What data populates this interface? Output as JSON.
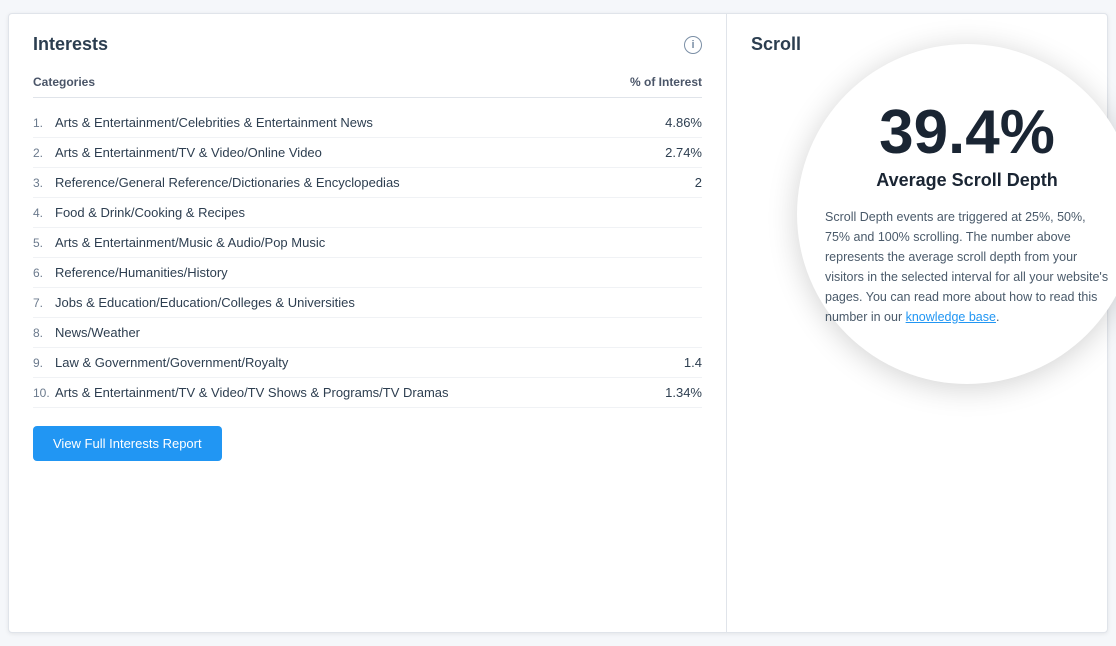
{
  "interests_panel": {
    "title": "Interests",
    "info_icon_label": "i",
    "table": {
      "col_category": "Categories",
      "col_percent": "% of Interest",
      "rows": [
        {
          "num": "1.",
          "name": "Arts & Entertainment/Celebrities & Entertainment News",
          "pct": "4.86%"
        },
        {
          "num": "2.",
          "name": "Arts & Entertainment/TV & Video/Online Video",
          "pct": "2.74%"
        },
        {
          "num": "3.",
          "name": "Reference/General Reference/Dictionaries & Encyclopedias",
          "pct": "2"
        },
        {
          "num": "4.",
          "name": "Food & Drink/Cooking & Recipes",
          "pct": ""
        },
        {
          "num": "5.",
          "name": "Arts & Entertainment/Music & Audio/Pop Music",
          "pct": ""
        },
        {
          "num": "6.",
          "name": "Reference/Humanities/History",
          "pct": ""
        },
        {
          "num": "7.",
          "name": "Jobs & Education/Education/Colleges & Universities",
          "pct": ""
        },
        {
          "num": "8.",
          "name": "News/Weather",
          "pct": ""
        },
        {
          "num": "9.",
          "name": "Law & Government/Government/Royalty",
          "pct": "1.4"
        },
        {
          "num": "10.",
          "name": "Arts & Entertainment/TV & Video/TV Shows & Programs/TV Dramas",
          "pct": "1.34%"
        }
      ]
    },
    "button_label": "View Full Interests Report"
  },
  "scroll_panel": {
    "title": "Scroll",
    "circle": {
      "big_percent": "39.4%",
      "label": "Average Scroll Depth",
      "description_1": "Scroll Depth events are triggered at 25%, 50%, 75% and 100% scrolling. The number above represents the average scroll depth from your visitors in the selected interval for all your website's pages. You can read more about how to read this number in our ",
      "link_text": "knowledge base",
      "description_2": "."
    }
  }
}
